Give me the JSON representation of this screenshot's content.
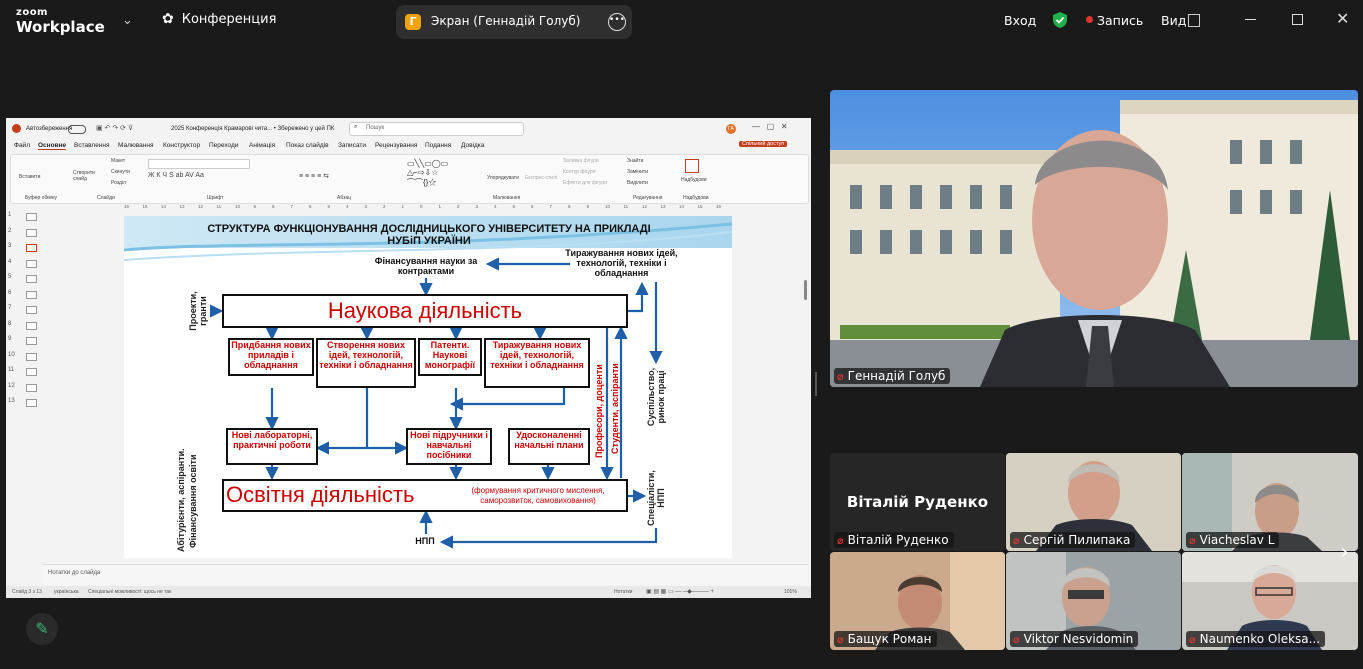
{
  "app": {
    "logo_top": "zoom",
    "logo_bottom": "Workplace",
    "meeting_label": "Конференция",
    "share_pill": {
      "initial": "Г",
      "label": "Экран (Геннадій Голуб)"
    },
    "login": "Вход",
    "record": "Запись",
    "view": "Вид",
    "colors": {
      "accent": "#0b5cff",
      "record": "#e0352b",
      "shield": "#21b14b"
    }
  },
  "ppt": {
    "autosave": "Автозбереження",
    "doc_title": "2025 Конференція Крамарові чита... • Збережено у цей ПК",
    "search_placeholder": "Пошук",
    "share_button": "Спільний доступ",
    "tabs": [
      "Файл",
      "Основне",
      "Вставлення",
      "Малювання",
      "Конструктор",
      "Переходи",
      "Анімація",
      "Показ слайдів",
      "Записати",
      "Рецензування",
      "Подання",
      "Довідка"
    ],
    "ribbon_groups": [
      "Буфер обміну",
      "Слайди",
      "Шрифт",
      "Абзац",
      "Малювання",
      "Редагування",
      "Надбудови"
    ],
    "ribbon_items": {
      "paste": "Вставити",
      "new_slide": "Створити слайд",
      "layout": "Макет",
      "reset": "Скинути",
      "section": "Розділ",
      "arrange": "Упорядкувати",
      "quick_styles": "Експрес-стилі",
      "shape_fill": "Заливка фігури",
      "shape_outline": "Контур фігури",
      "shape_effects": "Ефекти для фігури",
      "find": "Знайти",
      "replace": "Замінити",
      "select": "Виділити",
      "addins": "Надбудови"
    },
    "ruler": [
      "16",
      "15",
      "14",
      "13",
      "12",
      "11",
      "10",
      "9",
      "8",
      "7",
      "6",
      "5",
      "4",
      "3",
      "2",
      "1",
      "0",
      "1",
      "2",
      "3",
      "4",
      "5",
      "6",
      "7",
      "8",
      "9",
      "10",
      "11",
      "12",
      "13",
      "14",
      "15",
      "16"
    ],
    "thumbnails": [
      "1",
      "2",
      "3",
      "4",
      "5",
      "6",
      "7",
      "8",
      "9",
      "10",
      "11",
      "12",
      "13"
    ],
    "notes_placeholder": "Нотатки до слайда",
    "status": {
      "slide": "Слайд 3 з 13",
      "lang": "українська",
      "access": "Спеціальні можливості: щось не так",
      "notes": "Нотатки",
      "zoom": "101%"
    }
  },
  "slide": {
    "title": "СТРУКТУРА ФУНКЦІОНУВАННЯ ДОСЛІДНИЦЬКОГО УНІВЕРСИТЕТУ НА ПРИКЛАДІ НУБіП УКРАЇНИ",
    "financing": "Фінансування науки за контрактами",
    "replication_top": "Тиражування нових ідей, технологій, техніки і обладнання",
    "projects": "Проекти, гранти",
    "science": "Наукова діяльність",
    "boxes_top": [
      "Придбання нових приладів і обладнання",
      "Створення нових ідей, технологій, техніки і обладнання",
      "Патенти. Наукові монографії",
      "Тиражування нових ідей, технологій, техніки і обладнання"
    ],
    "boxes_mid": [
      "Нові лабораторні, практичні роботи",
      "Нові підручники і навчальні посібники",
      "Удосконаленні начальні плани"
    ],
    "professors": "Професори, доценти",
    "students": "Студенти, аспіранти",
    "society": "Суспільство, ринок праці",
    "education": "Освітня діяльність",
    "education_note": "(формування критичного мислення, саморозвиток, самовиховання)",
    "specialists": "Спеціалісти, НПП",
    "applicants": "Абітурієнти, аспіранти.",
    "edu_financing": "Фінансування освіти",
    "npp": "НПП"
  },
  "participants": {
    "speaker": "Геннадій Голуб",
    "grid": [
      {
        "name": "Віталій Руденко",
        "display": "Віталій Руденко"
      },
      {
        "name": "Сергій Пилипака"
      },
      {
        "name": "Viacheslav L"
      },
      {
        "name": "Бащук Роман"
      },
      {
        "name": "Viktor Nesvidomin"
      },
      {
        "name": "Naumenko Oleksa..."
      }
    ]
  }
}
